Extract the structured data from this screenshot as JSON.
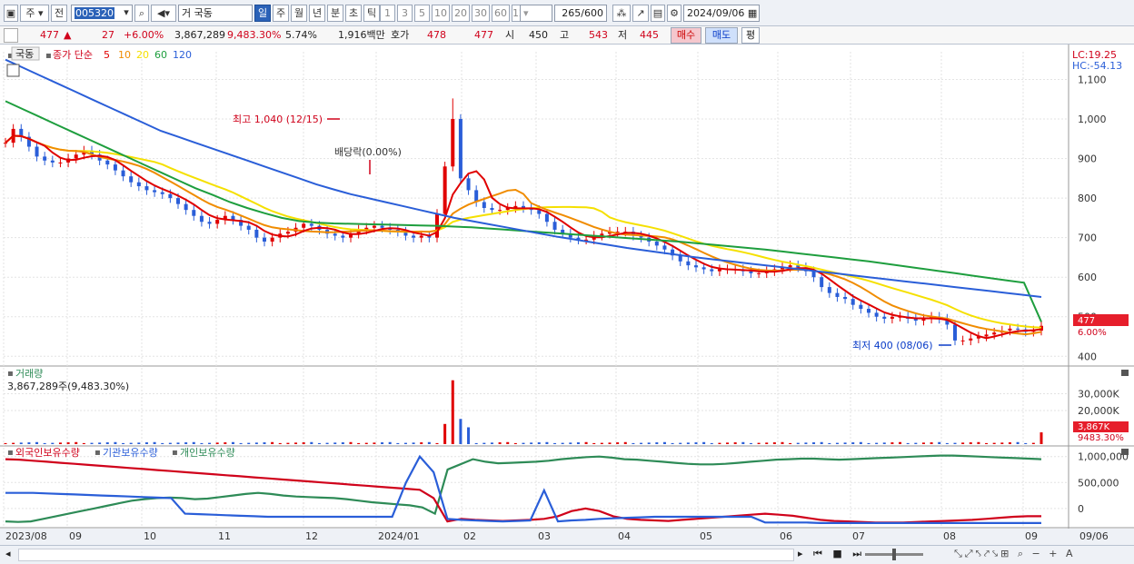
{
  "toolbar": {
    "market_code": "주",
    "prev_label": "전",
    "stock_code": "005320",
    "stock_name": "국동",
    "name_prefix": "거",
    "periods": [
      "일",
      "주",
      "월",
      "년",
      "분",
      "초",
      "틱"
    ],
    "selected_period": "일",
    "intervals": [
      "1",
      "3",
      "5",
      "10",
      "20",
      "30",
      "60",
      "120"
    ],
    "count_value": "265",
    "count_max": "/600",
    "date": "2024/09/06"
  },
  "quote": {
    "price": "477",
    "change": "27",
    "change_pct": "+6.00%",
    "volume": "3,867,289",
    "volume_ratio": "9,483.30%",
    "turnover": "5.74%",
    "amount": "1,916백만",
    "bid_label": "호가",
    "bid1": "478",
    "bid2": "477",
    "open_label": "시",
    "open": "450",
    "high_label": "고",
    "high": "543",
    "low_label": "저",
    "low": "445",
    "buy_label": "매수",
    "sell_label": "매도",
    "eval_label": "평"
  },
  "price_panel": {
    "name": "국동",
    "legend_title": "종가 단순",
    "ma_periods": [
      "5",
      "10",
      "20",
      "60",
      "120"
    ],
    "ma_colors": [
      "#e00000",
      "#f08c00",
      "#f5e000",
      "#1e9e3e",
      "#2a5ed8"
    ],
    "lc": "LC:19.25",
    "hc": "HC:-54.13",
    "annot_high": "최고 1,040 (12/15)",
    "annot_div": "배당락(0.00%)",
    "annot_low": "최저 400 (08/06)",
    "last_price": "477",
    "last_pct": "6.00%"
  },
  "volume_panel": {
    "title": "거래량",
    "value": "3,867,289주(9,483.30%)",
    "last_badge": "3,867K",
    "last_pct": "9483.30%"
  },
  "holdings_panel": {
    "legend": [
      "외국인보유수량",
      "기관보유수량",
      "개인보유수량"
    ],
    "colors": [
      "#d0021b",
      "#2a5ed8",
      "#2e8b57"
    ]
  },
  "status": {
    "tools": [
      "◀",
      "▶",
      "▐◀",
      "■",
      "▶▌"
    ]
  },
  "chart_data": [
    {
      "type": "candlestick",
      "name": "price",
      "x_ticks": [
        "2023/08",
        "09",
        "10",
        "11",
        "12",
        "2024/01",
        "02",
        "03",
        "04",
        "05",
        "06",
        "07",
        "08",
        "09",
        "09/06"
      ],
      "y_ticks": [
        400,
        500,
        600,
        700,
        800,
        900,
        1000,
        1100
      ],
      "ylim": [
        380,
        1170
      ],
      "close": [
        940,
        975,
        955,
        930,
        905,
        895,
        890,
        890,
        900,
        910,
        920,
        910,
        895,
        885,
        870,
        855,
        840,
        830,
        820,
        815,
        810,
        800,
        785,
        770,
        755,
        740,
        735,
        745,
        755,
        745,
        730,
        720,
        700,
        690,
        700,
        710,
        715,
        725,
        735,
        730,
        720,
        710,
        705,
        700,
        710,
        720,
        725,
        730,
        725,
        720,
        715,
        705,
        700,
        705,
        700,
        760,
        880,
        1000,
        850,
        820,
        790,
        775,
        770,
        770,
        775,
        780,
        775,
        770,
        760,
        740,
        720,
        710,
        700,
        695,
        695,
        705,
        710,
        715,
        715,
        715,
        705,
        700,
        690,
        680,
        670,
        655,
        640,
        630,
        625,
        620,
        615,
        620,
        620,
        620,
        615,
        610,
        610,
        615,
        620,
        625,
        630,
        625,
        615,
        600,
        575,
        560,
        550,
        545,
        530,
        520,
        510,
        500,
        495,
        500,
        500,
        495,
        490,
        495,
        500,
        495,
        480,
        440,
        440,
        445,
        450,
        455,
        460,
        465,
        470,
        468,
        462,
        465,
        477
      ],
      "ma_values": {
        "ma120": [
          1150,
          1130,
          1110,
          1090,
          1070,
          1050,
          1030,
          1010,
          990,
          970,
          955,
          940,
          925,
          910,
          895,
          880,
          865,
          850,
          835,
          822,
          810,
          800,
          790,
          780,
          770,
          760,
          750,
          742,
          734,
          726,
          718,
          710,
          702,
          695,
          688,
          681,
          674,
          668,
          662,
          656,
          650,
          645,
          640,
          635,
          630,
          625,
          620,
          615,
          610,
          605,
          600,
          595,
          590,
          585,
          580,
          575,
          570,
          565,
          560,
          555,
          550
        ],
        "ma60": [
          1045,
          1025,
          1005,
          985,
          965,
          945,
          925,
          905,
          885,
          865,
          845,
          825,
          808,
          790,
          775,
          762,
          750,
          742,
          738,
          736,
          735,
          734,
          733,
          732,
          731,
          730,
          728,
          726,
          723,
          720,
          717,
          714,
          711,
          708,
          705,
          702,
          699,
          696,
          693,
          690,
          686,
          682,
          678,
          674,
          670,
          665,
          660,
          655,
          650,
          645,
          640,
          634,
          628,
          622,
          616,
          610,
          604,
          598,
          592,
          586,
          487
        ]
      }
    },
    {
      "type": "bar",
      "name": "volume",
      "y_ticks": [
        "30,000K",
        "20,000K"
      ],
      "spikes": [
        {
          "x_index": 57,
          "value": 38000
        },
        {
          "x_index": 58,
          "value": 15000
        },
        {
          "x_index": 56,
          "value": 12000
        },
        {
          "x_index": 59,
          "value": 10000
        }
      ]
    },
    {
      "type": "line",
      "name": "holdings",
      "y_ticks": [
        "1,000,000",
        "500,000",
        "0"
      ]
    }
  ]
}
